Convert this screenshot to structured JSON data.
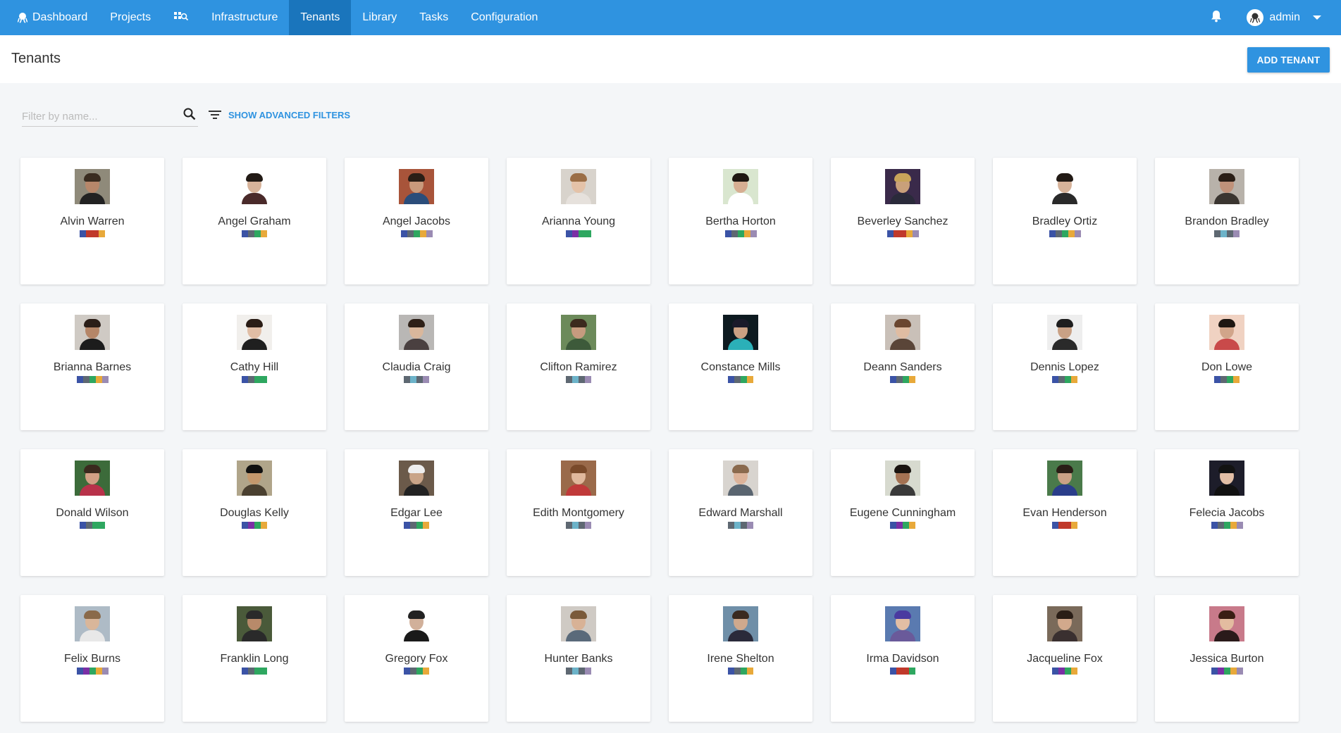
{
  "nav": {
    "items": [
      {
        "label": "Dashboard",
        "icon": "octopus-icon",
        "active": false
      },
      {
        "label": "Projects",
        "active": false
      },
      {
        "label": "",
        "icon": "search-machines-icon",
        "active": false
      },
      {
        "label": "Infrastructure",
        "active": false
      },
      {
        "label": "Tenants",
        "active": true
      },
      {
        "label": "Library",
        "active": false
      },
      {
        "label": "Tasks",
        "active": false
      },
      {
        "label": "Configuration",
        "active": false
      }
    ],
    "user": "admin"
  },
  "header": {
    "title": "Tenants",
    "add_button": "ADD TENANT"
  },
  "filter": {
    "placeholder": "Filter by name...",
    "advanced": "SHOW ADVANCED FILTERS"
  },
  "colors": {
    "accent": "#2f93e0",
    "tag_palette": [
      "#3b53a6",
      "#5e6872",
      "#c0392b",
      "#e8a93a",
      "#2ea760",
      "#7b2fa5",
      "#6cb3c9",
      "#9a8bb3"
    ]
  },
  "tenants": [
    {
      "name": "Alvin Warren",
      "tags": [
        "#3b53a6",
        "#c0392b",
        "#c0392b",
        "#e8a93a"
      ],
      "skin": "#b7876a",
      "hair": "#3a2c20",
      "bg": "#8f8a7a",
      "shirt": "#222222"
    },
    {
      "name": "Angel Graham",
      "tags": [
        "#3b53a6",
        "#5e6872",
        "#2ea760",
        "#e8a93a"
      ],
      "skin": "#d7b39a",
      "hair": "#221a15",
      "bg": "#ffffff",
      "shirt": "#4a2a2a"
    },
    {
      "name": "Angel Jacobs",
      "tags": [
        "#3b53a6",
        "#5e6872",
        "#2ea760",
        "#e8a93a",
        "#9a8bb3"
      ],
      "skin": "#c99a7c",
      "hair": "#2a1e16",
      "bg": "#a8543a",
      "shirt": "#2b4d7a"
    },
    {
      "name": "Arianna Young",
      "tags": [
        "#3b53a6",
        "#7b2fa5",
        "#2ea760",
        "#2ea760"
      ],
      "skin": "#e4c2a8",
      "hair": "#9b6e46",
      "bg": "#d8d3cc",
      "shirt": "#e6e1dc"
    },
    {
      "name": "Bertha Horton",
      "tags": [
        "#3b53a6",
        "#5e6872",
        "#2ea760",
        "#e8a93a",
        "#9a8bb3"
      ],
      "skin": "#d6ae92",
      "hair": "#1f1712",
      "bg": "#d9e6cf",
      "shirt": "#ffffff"
    },
    {
      "name": "Beverley Sanchez",
      "tags": [
        "#3b53a6",
        "#c0392b",
        "#c0392b",
        "#e8a93a",
        "#9a8bb3"
      ],
      "skin": "#c9a07a",
      "hair": "#c8a45a",
      "bg": "#3a2a4a",
      "shirt": "#2a2a3a"
    },
    {
      "name": "Bradley Ortiz",
      "tags": [
        "#3b53a6",
        "#5e6872",
        "#2ea760",
        "#e8a93a",
        "#9a8bb3"
      ],
      "skin": "#d7b39a",
      "hair": "#221a15",
      "bg": "#ffffff",
      "shirt": "#2a2a2a"
    },
    {
      "name": "Brandon Bradley",
      "tags": [
        "#5e6872",
        "#6cb3c9",
        "#5e6872",
        "#9a8bb3"
      ],
      "skin": "#c0927a",
      "hair": "#2a1e16",
      "bg": "#b8b2aa",
      "shirt": "#3a3530"
    },
    {
      "name": "Brianna Barnes",
      "tags": [
        "#3b53a6",
        "#5e6872",
        "#2ea760",
        "#e8a93a",
        "#9a8bb3"
      ],
      "skin": "#b58668",
      "hair": "#2b1e18",
      "bg": "#cfcac4",
      "shirt": "#1c1c1c"
    },
    {
      "name": "Cathy Hill",
      "tags": [
        "#3b53a6",
        "#5e6872",
        "#2ea760",
        "#2ea760"
      ],
      "skin": "#e0bda5",
      "hair": "#2a1d16",
      "bg": "#f1efec",
      "shirt": "#1f1f1f"
    },
    {
      "name": "Claudia Craig",
      "tags": [
        "#5e6872",
        "#6cb3c9",
        "#5e6872",
        "#9a8bb3"
      ],
      "skin": "#d9b79c",
      "hair": "#2e2018",
      "bg": "#b9b7b5",
      "shirt": "#4a4040"
    },
    {
      "name": "Clifton Ramirez",
      "tags": [
        "#5e6872",
        "#6cb3c9",
        "#5e6872",
        "#9a8bb3"
      ],
      "skin": "#c69b7f",
      "hair": "#3b2a1e",
      "bg": "#6c8a5a",
      "shirt": "#3d5a3a"
    },
    {
      "name": "Constance Mills",
      "tags": [
        "#3b53a6",
        "#5e6872",
        "#2ea760",
        "#e8a93a"
      ],
      "skin": "#caa083",
      "hair": "#1a1a2a",
      "bg": "#0d1a20",
      "shirt": "#2bb0b8"
    },
    {
      "name": "Deann Sanders",
      "tags": [
        "#3b53a6",
        "#5e6872",
        "#2ea760",
        "#e8a93a"
      ],
      "skin": "#dfbca2",
      "hair": "#6a4630",
      "bg": "#c9c0b8",
      "shirt": "#5a4538"
    },
    {
      "name": "Dennis Lopez",
      "tags": [
        "#3b53a6",
        "#5e6872",
        "#2ea760",
        "#e8a93a"
      ],
      "skin": "#c9a185",
      "hair": "#1e1e1e",
      "bg": "#eeeeee",
      "shirt": "#2a2a2a"
    },
    {
      "name": "Don Lowe",
      "tags": [
        "#3b53a6",
        "#5e6872",
        "#2ea760",
        "#e8a93a"
      ],
      "skin": "#d1a58a",
      "hair": "#1e1712",
      "bg": "#f0d2c2",
      "shirt": "#c94a4a"
    },
    {
      "name": "Donald Wilson",
      "tags": [
        "#3b53a6",
        "#5e6872",
        "#2ea760",
        "#2ea760"
      ],
      "skin": "#d2a085",
      "hair": "#3a2a1e",
      "bg": "#3c6b3a",
      "shirt": "#b8324a"
    },
    {
      "name": "Douglas Kelly",
      "tags": [
        "#3b53a6",
        "#7b2fa5",
        "#2ea760",
        "#e8a93a"
      ],
      "skin": "#c4986d",
      "hair": "#111111",
      "bg": "#b0a58a",
      "shirt": "#4a4030"
    },
    {
      "name": "Edgar Lee",
      "tags": [
        "#3b53a6",
        "#5e6872",
        "#2ea760",
        "#e8a93a"
      ],
      "skin": "#c9a488",
      "hair": "#eeeeee",
      "bg": "#6b5a4a",
      "shirt": "#222222"
    },
    {
      "name": "Edith Montgomery",
      "tags": [
        "#5e6872",
        "#6cb3c9",
        "#5e6872",
        "#9a8bb3"
      ],
      "skin": "#e0b89c",
      "hair": "#7a4a2a",
      "bg": "#9a6a4a",
      "shirt": "#c03a3a"
    },
    {
      "name": "Edward Marshall",
      "tags": [
        "#5e6872",
        "#6cb3c9",
        "#5e6872",
        "#9a8bb3"
      ],
      "skin": "#dcb39a",
      "hair": "#8a6a4e",
      "bg": "#d8d4cf",
      "shirt": "#5a6570"
    },
    {
      "name": "Eugene Cunningham",
      "tags": [
        "#3b53a6",
        "#7b2fa5",
        "#2ea760",
        "#e8a93a"
      ],
      "skin": "#a47253",
      "hair": "#1a1410",
      "bg": "#d7dacf",
      "shirt": "#3a3a3a"
    },
    {
      "name": "Evan Henderson",
      "tags": [
        "#3b53a6",
        "#c0392b",
        "#c0392b",
        "#e8a93a"
      ],
      "skin": "#caa185",
      "hair": "#2a1e16",
      "bg": "#4a7a4a",
      "shirt": "#2a3d8a"
    },
    {
      "name": "Felecia Jacobs",
      "tags": [
        "#3b53a6",
        "#5e6872",
        "#2ea760",
        "#e8a93a",
        "#9a8bb3"
      ],
      "skin": "#e2bfa6",
      "hair": "#121212",
      "bg": "#1d1d2a",
      "shirt": "#111111"
    },
    {
      "name": "Felix Burns",
      "tags": [
        "#3b53a6",
        "#7b2fa5",
        "#2ea760",
        "#e8a93a",
        "#9a8bb3"
      ],
      "skin": "#d9b69a",
      "hair": "#8a6a4a",
      "bg": "#aebbc6",
      "shirt": "#e8e8e8"
    },
    {
      "name": "Franklin Long",
      "tags": [
        "#3b53a6",
        "#5e6872",
        "#2ea760",
        "#2ea760"
      ],
      "skin": "#b88a6a",
      "hair": "#2a2a2a",
      "bg": "#4a5a3a",
      "shirt": "#2a2a2a"
    },
    {
      "name": "Gregory Fox",
      "tags": [
        "#3b53a6",
        "#5e6872",
        "#2ea760",
        "#e8a93a"
      ],
      "skin": "#d1b09a",
      "hair": "#222222",
      "bg": "#ffffff",
      "shirt": "#1a1a1a"
    },
    {
      "name": "Hunter Banks",
      "tags": [
        "#5e6872",
        "#6cb3c9",
        "#5e6872",
        "#9a8bb3"
      ],
      "skin": "#d8b296",
      "hair": "#7a5a3a",
      "bg": "#cfcac4",
      "shirt": "#5a6a7a"
    },
    {
      "name": "Irene Shelton",
      "tags": [
        "#3b53a6",
        "#5e6872",
        "#2ea760",
        "#e8a93a"
      ],
      "skin": "#cfa98d",
      "hair": "#3a2a20",
      "bg": "#6f8fa8",
      "shirt": "#2a2a3a"
    },
    {
      "name": "Irma Davidson",
      "tags": [
        "#3b53a6",
        "#c0392b",
        "#c0392b",
        "#2ea760"
      ],
      "skin": "#e2bea4",
      "hair": "#4a3aa0",
      "bg": "#5a7ab0",
      "shirt": "#6a5a9a"
    },
    {
      "name": "Jacqueline Fox",
      "tags": [
        "#3b53a6",
        "#7b2fa5",
        "#2ea760",
        "#e8a93a"
      ],
      "skin": "#d2a98c",
      "hair": "#2a1e16",
      "bg": "#7a6a5a",
      "shirt": "#3a3030"
    },
    {
      "name": "Jessica Burton",
      "tags": [
        "#3b53a6",
        "#7b2fa5",
        "#2ea760",
        "#e8a93a",
        "#9a8bb3"
      ],
      "skin": "#e3bca0",
      "hair": "#3a1e14",
      "bg": "#c87a8a",
      "shirt": "#2a1a1a"
    }
  ]
}
